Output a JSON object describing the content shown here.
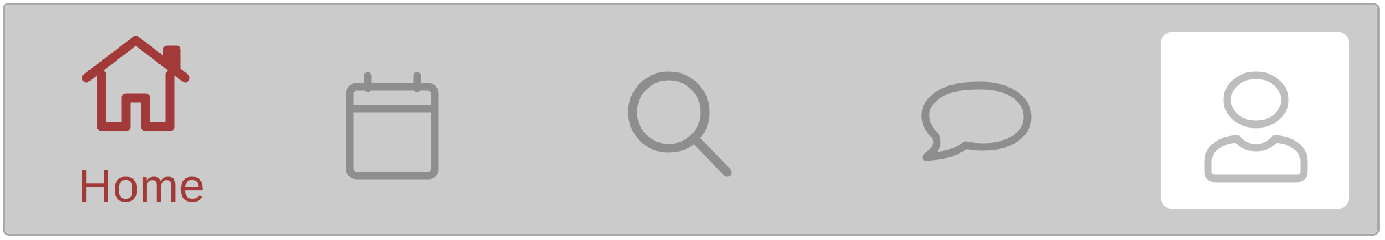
{
  "tabbar": {
    "active_color": "#a33a3a",
    "inactive_color": "#8e8e8e",
    "selected_highlight_color": "#ffffff",
    "tabs": [
      {
        "icon": "home-icon",
        "label": "Home",
        "active": true
      },
      {
        "icon": "calendar-icon",
        "label": "",
        "active": false
      },
      {
        "icon": "search-icon",
        "label": "",
        "active": false
      },
      {
        "icon": "chat-bubble-icon",
        "label": "",
        "active": false
      },
      {
        "icon": "profile-icon",
        "label": "",
        "active": false,
        "highlighted": true
      }
    ]
  }
}
